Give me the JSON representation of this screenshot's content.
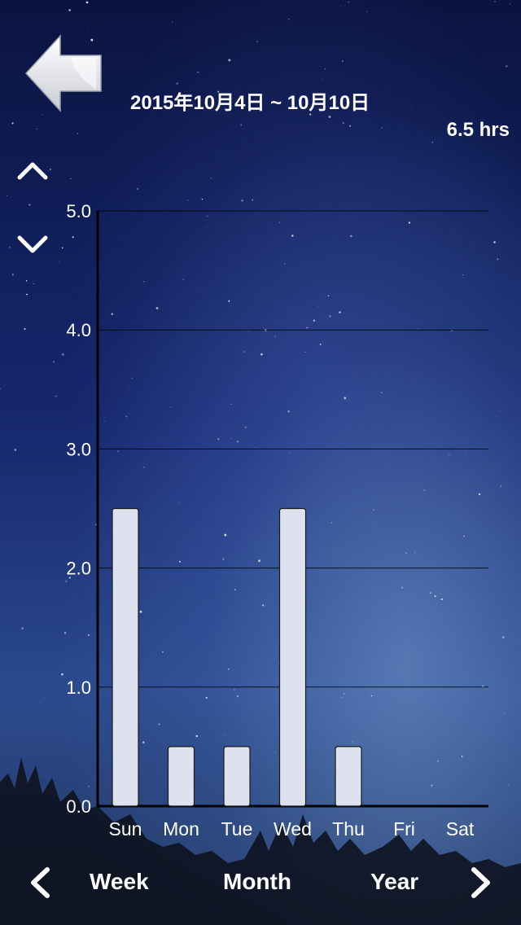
{
  "header": {
    "date_range": "2015年10月4日 ~ 10月10日",
    "total_hours": "6.5 hrs"
  },
  "icons": {
    "back": "back-arrow-icon",
    "scale_up": "chevron-up-icon",
    "scale_down": "chevron-down-icon",
    "prev": "chevron-left-icon",
    "next": "chevron-right-icon"
  },
  "chart_data": {
    "type": "bar",
    "categories": [
      "Sun",
      "Mon",
      "Tue",
      "Wed",
      "Thu",
      "Fri",
      "Sat"
    ],
    "values": [
      2.5,
      0.5,
      0.5,
      2.5,
      0.5,
      0,
      0
    ],
    "ylim": [
      0,
      5
    ],
    "yticks": [
      "0.0",
      "1.0",
      "2.0",
      "3.0",
      "4.0",
      "5.0"
    ],
    "grid": true,
    "bar_color": "#dde2ee"
  },
  "bottom_nav": {
    "week": "Week",
    "month": "Month",
    "year": "Year"
  },
  "colors": {
    "background": "#16276e",
    "text": "#ffffff"
  }
}
